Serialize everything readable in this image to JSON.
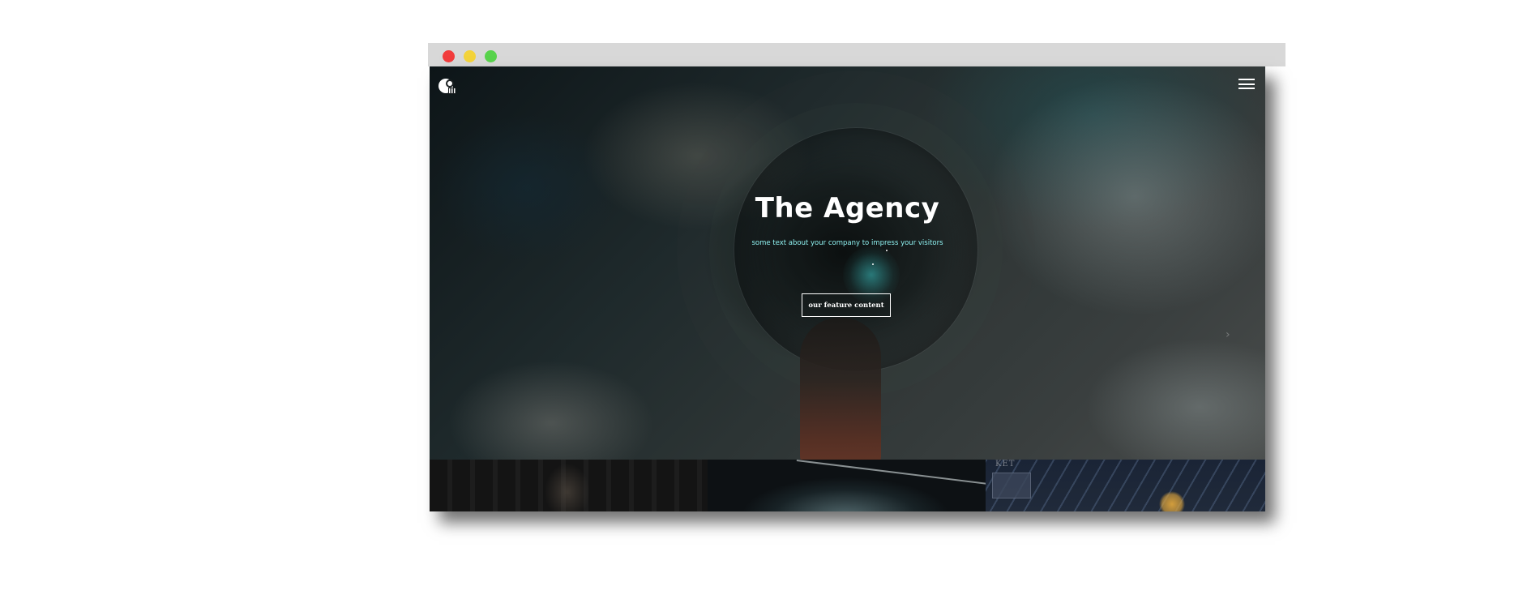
{
  "window": {
    "controls": [
      "close",
      "minimize",
      "zoom"
    ],
    "colors": {
      "close": "#f23c3c",
      "minimize": "#f3d33a",
      "zoom": "#58d34c"
    }
  },
  "nav": {
    "logo_icon": "camera-logo-icon",
    "menu_icon": "hamburger-menu-icon"
  },
  "hero": {
    "title": "The Agency",
    "subtitle": "some text about your company to impress your visitors",
    "cta_label": "our feature content",
    "accent_color": "#8ef0ef"
  },
  "thumbnails": [
    {
      "name": "thumb-interior"
    },
    {
      "name": "thumb-smoke"
    },
    {
      "name": "thumb-station",
      "sign_text": "KET"
    }
  ]
}
